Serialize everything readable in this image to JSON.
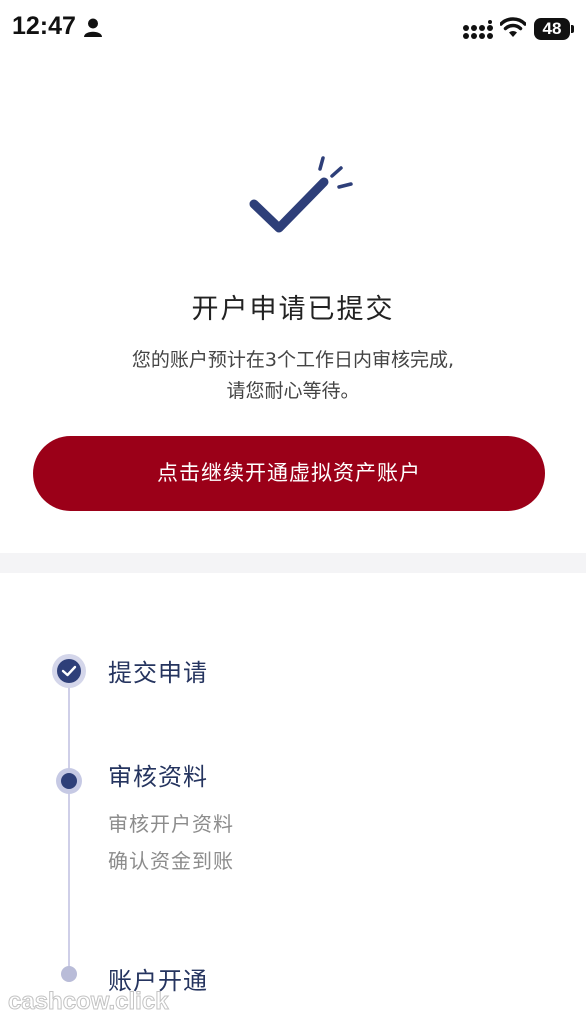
{
  "status_bar": {
    "time": "12:47",
    "battery": "48",
    "icons": [
      "person-icon",
      "signal-icon",
      "wifi-icon",
      "battery-icon"
    ]
  },
  "hero": {
    "icon": "checkmark-icon",
    "title": "开户申请已提交",
    "description_line1": "您的账户预计在3个工作日内审核完成,",
    "description_line2": "请您耐心等待。",
    "button_label": "点击继续开通虚拟资产账户"
  },
  "steps": [
    {
      "title": "提交申请",
      "status": "done"
    },
    {
      "title": "审核资料",
      "status": "active",
      "details": [
        "审核开户资料",
        "确认资金到账"
      ]
    },
    {
      "title": "账户开通",
      "status": "pending"
    }
  ],
  "watermark": "cashcow.click",
  "colors": {
    "brand_red": "#9b0018",
    "navy": "#2e3f79",
    "timeline": "#cfcfe8"
  }
}
